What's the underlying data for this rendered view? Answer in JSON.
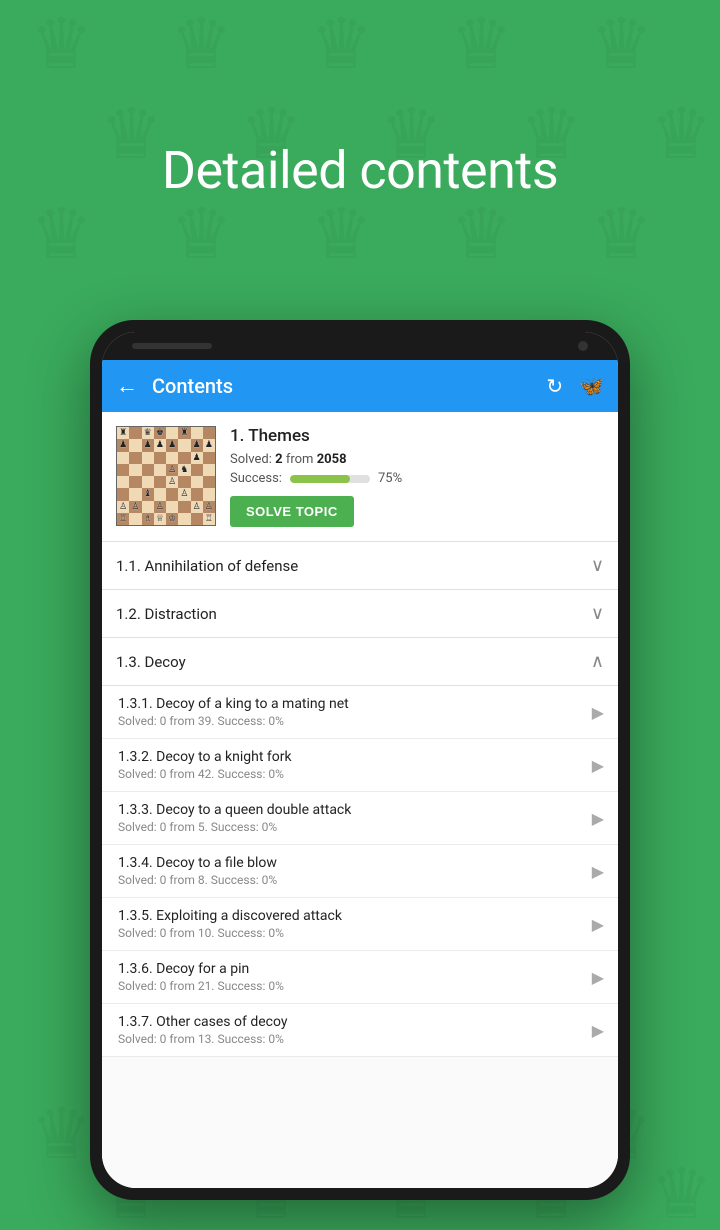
{
  "page": {
    "background_color": "#3aaa5c",
    "title": "Detailed contents"
  },
  "app_bar": {
    "title": "Contents",
    "back_label": "←",
    "icon_refresh": "↻",
    "icon_butterfly": "🦋"
  },
  "topic_card": {
    "topic_number": "1.",
    "topic_name": "Themes",
    "solved_label": "Solved:",
    "solved_count": "2",
    "solved_from": "from",
    "solved_total": "2058",
    "success_label": "Success:",
    "success_percent": "75%",
    "progress_value": 75,
    "solve_button_label": "SOLVE TOPIC"
  },
  "sections": [
    {
      "id": "1.1",
      "title": "1.1. Annihilation of defense",
      "expanded": false,
      "items": []
    },
    {
      "id": "1.2",
      "title": "1.2. Distraction",
      "expanded": false,
      "items": []
    },
    {
      "id": "1.3",
      "title": "1.3. Decoy",
      "expanded": true,
      "items": [
        {
          "id": "1.3.1",
          "title": "1.3.1. Decoy of a king to a mating net",
          "stats": "Solved: 0 from 39. Success: 0%"
        },
        {
          "id": "1.3.2",
          "title": "1.3.2. Decoy to a knight fork",
          "stats": "Solved: 0 from 42. Success: 0%"
        },
        {
          "id": "1.3.3",
          "title": "1.3.3. Decoy to a queen double attack",
          "stats": "Solved: 0 from 5. Success: 0%"
        },
        {
          "id": "1.3.4",
          "title": "1.3.4. Decoy to a file blow",
          "stats": "Solved: 0 from 8. Success: 0%"
        },
        {
          "id": "1.3.5",
          "title": "1.3.5. Exploiting a discovered attack",
          "stats": "Solved: 0 from 10. Success: 0%"
        },
        {
          "id": "1.3.6",
          "title": "1.3.6. Decoy for a pin",
          "stats": "Solved: 0 from 21. Success: 0%"
        },
        {
          "id": "1.3.7",
          "title": "1.3.7. Other cases of decoy",
          "stats": "Solved: 0 from 13. Success: 0%"
        }
      ]
    }
  ]
}
